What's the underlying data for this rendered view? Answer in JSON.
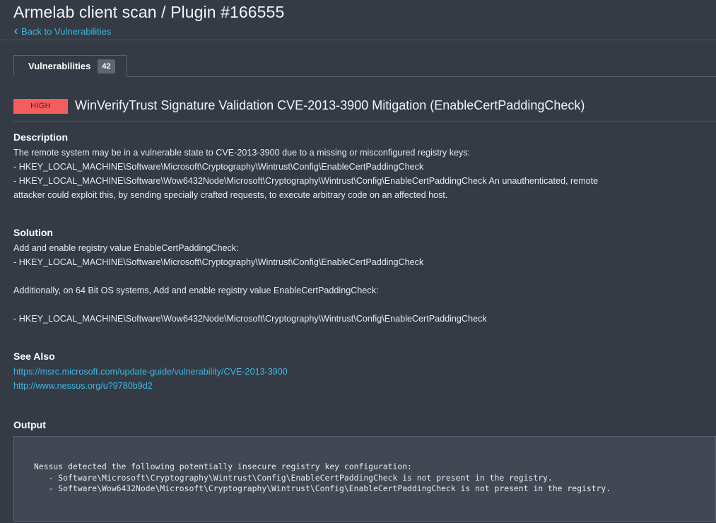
{
  "header": {
    "title": "Armelab client scan / Plugin #166555",
    "back_label": "Back to Vulnerabilities"
  },
  "tabs": [
    {
      "label": "Vulnerabilities",
      "count": "42"
    }
  ],
  "vulnerability": {
    "severity": "HIGH",
    "severity_color": "#f35d5d",
    "title": "WinVerifyTrust Signature Validation CVE-2013-3900 Mitigation (EnableCertPaddingCheck)"
  },
  "description": {
    "heading": "Description",
    "lines": [
      "The remote system may be in a vulnerable state to CVE-2013-3900 due to a missing or misconfigured registry keys:",
      "- HKEY_LOCAL_MACHINE\\Software\\Microsoft\\Cryptography\\Wintrust\\Config\\EnableCertPaddingCheck",
      "- HKEY_LOCAL_MACHINE\\Software\\Wow6432Node\\Microsoft\\Cryptography\\Wintrust\\Config\\EnableCertPaddingCheck An unauthenticated, remote",
      "attacker could exploit this, by sending specially crafted requests, to execute arbitrary code on an affected host."
    ]
  },
  "solution": {
    "heading": "Solution",
    "lines": [
      "Add and enable registry value EnableCertPaddingCheck:",
      "- HKEY_LOCAL_MACHINE\\Software\\Microsoft\\Cryptography\\Wintrust\\Config\\EnableCertPaddingCheck",
      "Additionally, on 64 Bit OS systems, Add and enable registry value EnableCertPaddingCheck:",
      "- HKEY_LOCAL_MACHINE\\Software\\Wow6432Node\\Microsoft\\Cryptography\\Wintrust\\Config\\EnableCertPaddingCheck"
    ]
  },
  "see_also": {
    "heading": "See Also",
    "links": [
      "https://msrc.microsoft.com/update-guide/vulnerability/CVE-2013-3900",
      "http://www.nessus.org/u?9780b9d2"
    ]
  },
  "output": {
    "heading": "Output",
    "lines": [
      "Nessus detected the following potentially insecure registry key configuration:",
      "   - Software\\Microsoft\\Cryptography\\Wintrust\\Config\\EnableCertPaddingCheck is not present in the registry.",
      "   - Software\\Wow6432Node\\Microsoft\\Cryptography\\Wintrust\\Config\\EnableCertPaddingCheck is not present in the registry."
    ]
  },
  "colors": {
    "background": "#353b45",
    "link": "#3fb6e0",
    "accent_high": "#f35d5d"
  },
  "icons": {
    "back": "chevron-left-icon"
  }
}
